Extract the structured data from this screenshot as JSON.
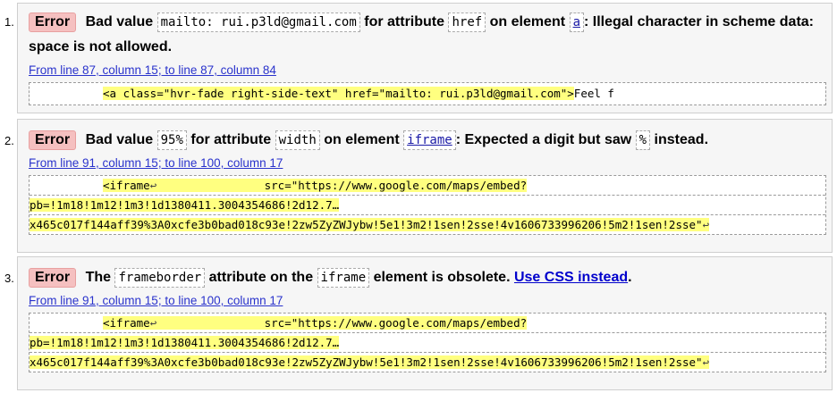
{
  "messages": [
    {
      "number": "1.",
      "badge": "Error",
      "text_parts": [
        "Bad value",
        "mailto: rui.p3ld@gmail.com",
        "for attribute",
        "href",
        "on element",
        "a",
        ": Illegal character in scheme data: space is not allowed."
      ],
      "location": "From line 87, column 15; to line 87, column 84",
      "extract_lines": [
        {
          "pre": "",
          "marked": "<a class=\"hvr-fade right-side-text\" href=\"mailto: rui.p3ld@gmail.com\">",
          "post": "Feel f"
        }
      ]
    },
    {
      "number": "2.",
      "badge": "Error",
      "text_parts": [
        "Bad value",
        "95%",
        "for attribute",
        "width",
        "on element",
        "iframe",
        ": Expected a digit but saw",
        "%",
        "instead."
      ],
      "location": "From line 91, column 15; to line 100, column 17",
      "extract_lines": [
        {
          "marked": "<iframe",
          "return": "↩",
          "tail": "                src=\"https://www.google.com/maps/embed?"
        },
        {
          "marked": "pb=!1m18!1m12!1m3!1d1380411.3004354686!2d12.7…"
        },
        {
          "marked": "x465c017f144aff39%3A0xcfe3b0bad018c93e!2zw5ZyZWJybw!5e1!3m2!1sen!2sse!4v1606733996206!5m2!1sen!2sse\"",
          "return": "↩"
        }
      ]
    },
    {
      "number": "3.",
      "badge": "Error",
      "text_parts": [
        "The",
        "frameborder",
        "attribute on the",
        "iframe",
        "element is obsolete.",
        "Use CSS instead",
        "."
      ],
      "location": "From line 91, column 15; to line 100, column 17",
      "extract_lines": [
        {
          "marked": "<iframe",
          "return": "↩",
          "tail": "                src=\"https://www.google.com/maps/embed?"
        },
        {
          "marked": "pb=!1m18!1m12!1m3!1d1380411.3004354686!2d12.7…"
        },
        {
          "marked": "x465c017f144aff39%3A0xcfe3b0bad018c93e!2zw5ZyZWJybw!5e1!3m2!1sen!2sse!4v1606733996206!5m2!1sen!2sse\"",
          "return": "↩"
        }
      ]
    }
  ],
  "colors": {
    "badge_bg": "#f5c0c0",
    "highlight": "#ffff80",
    "link": "#2a33cc",
    "box_bg": "#f6f6f6"
  }
}
